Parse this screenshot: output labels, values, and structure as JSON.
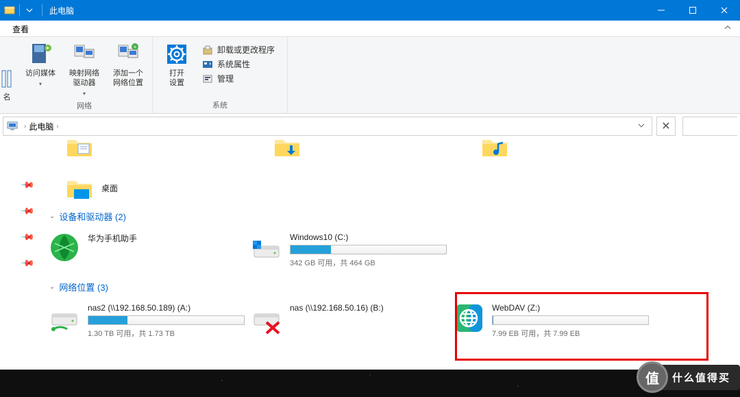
{
  "titlebar": {
    "title": "此电脑"
  },
  "tabs": {
    "view": "查看"
  },
  "ribbon": {
    "cutoff_label": "名",
    "network": {
      "media": "访问媒体",
      "map_drive": "映射网络\n驱动器",
      "add_location": "添加一个\n网络位置",
      "group_label": "网络"
    },
    "system": {
      "open_settings": "打开\n设置",
      "uninstall": "卸载或更改程序",
      "properties": "系统属性",
      "manage": "管理",
      "group_label": "系统"
    }
  },
  "addressbar": {
    "location": "此电脑"
  },
  "pins": [
    "📌",
    "📌",
    "📌",
    "📌"
  ],
  "folders_partial": [
    {
      "name": "文档"
    },
    {
      "name": "下载"
    },
    {
      "name": "音乐"
    }
  ],
  "folder_desktop": "桌面",
  "sections": {
    "devices": {
      "label": "设备和驱动器",
      "count": 2
    },
    "network": {
      "label": "网络位置",
      "count": 3
    }
  },
  "devices": [
    {
      "name": "华为手机助手",
      "type": "app"
    },
    {
      "name": "Windows10 (C:)",
      "type": "drive",
      "fill_pct": 26,
      "sub": "342 GB 可用，共 464 GB"
    }
  ],
  "netloc": [
    {
      "name": "nas2 (\\\\192.168.50.189) (A:)",
      "type": "netdrive",
      "fill_pct": 25,
      "sub": "1.30 TB 可用，共 1.73 TB"
    },
    {
      "name": "nas (\\\\192.168.50.16) (B:)",
      "type": "netdrive_off"
    },
    {
      "name": "WebDAV (Z:)",
      "type": "webdav",
      "fill_pct": 0.3,
      "sub": "7.99 EB 可用，共 7.99 EB"
    }
  ],
  "watermark": {
    "char": "值",
    "text": "什么值得买"
  }
}
